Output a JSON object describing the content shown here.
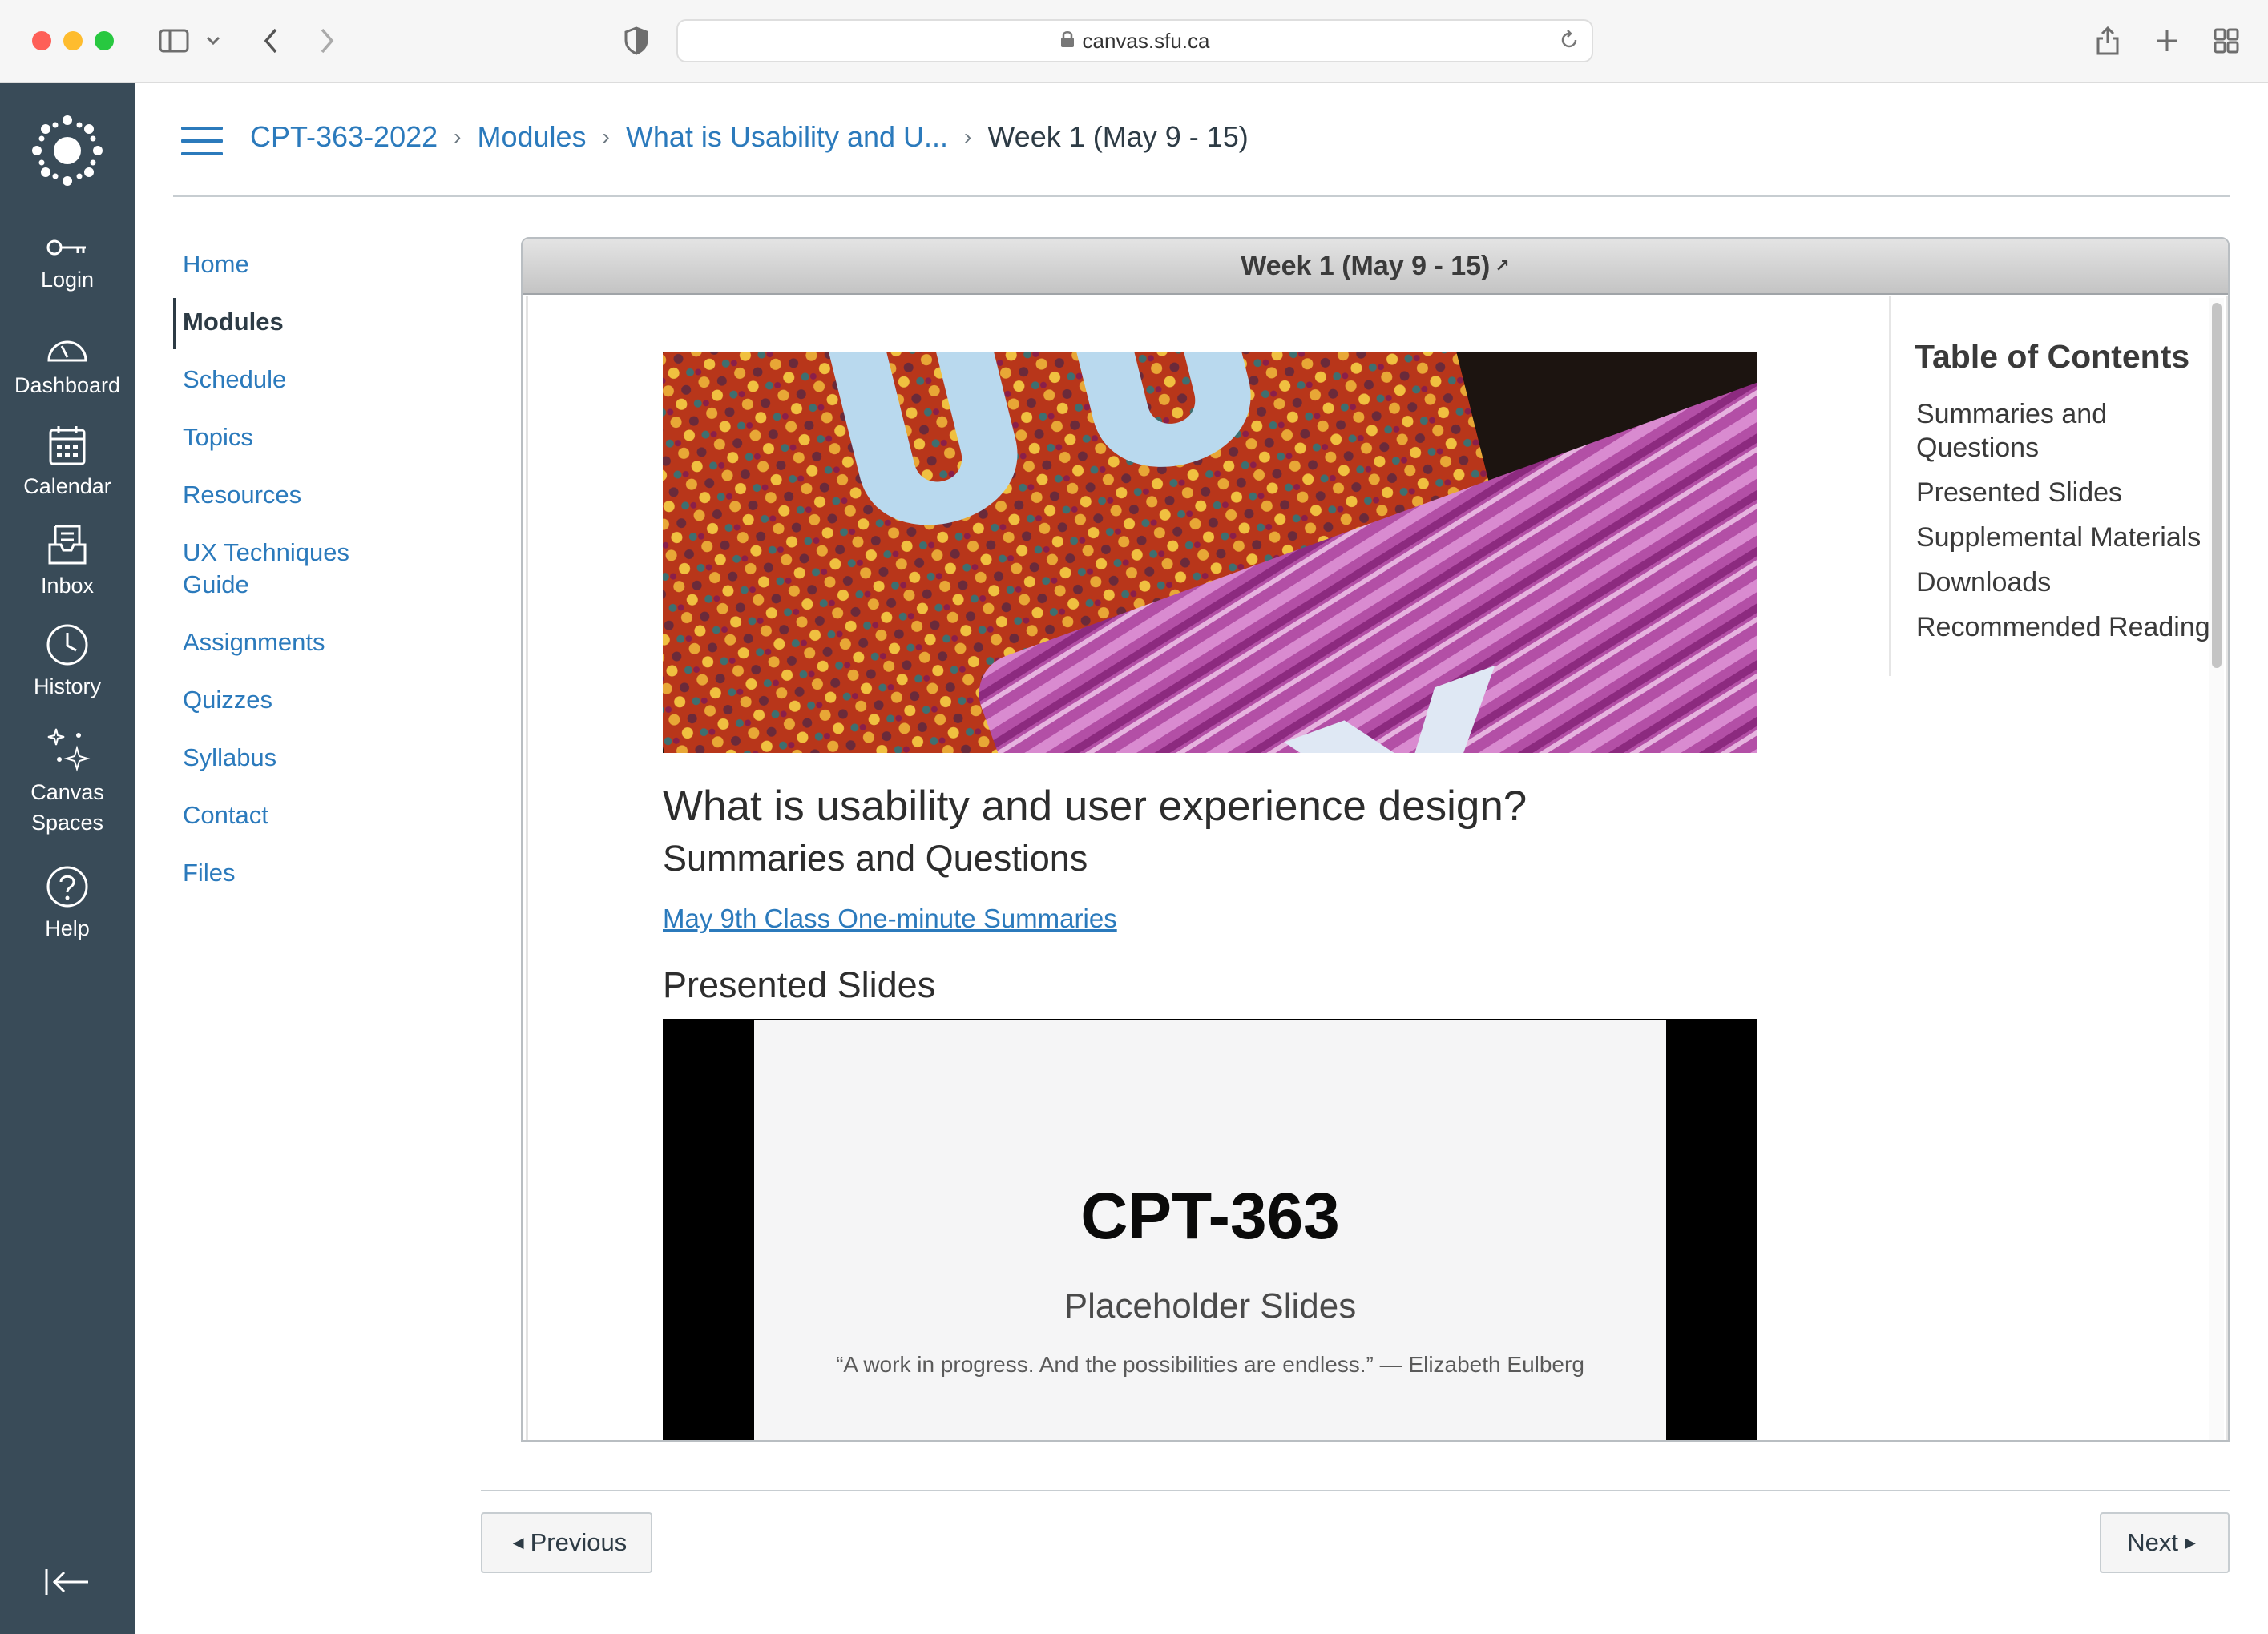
{
  "browser": {
    "url": "canvas.sfu.ca"
  },
  "global_nav": {
    "items": [
      {
        "label": "Login",
        "icon": "key-icon"
      },
      {
        "label": "Dashboard",
        "icon": "dashboard-icon"
      },
      {
        "label": "Calendar",
        "icon": "calendar-icon"
      },
      {
        "label": "Inbox",
        "icon": "inbox-icon"
      },
      {
        "label": "History",
        "icon": "clock-icon"
      },
      {
        "label": "Canvas",
        "label2": "Spaces",
        "icon": "sparkles-icon"
      },
      {
        "label": "Help",
        "icon": "help-icon"
      }
    ]
  },
  "breadcrumb": {
    "items": [
      "CPT-363-2022",
      "Modules",
      "What is Usability and U..."
    ],
    "current": "Week 1 (May 9 - 15)"
  },
  "course_nav": {
    "items": [
      "Home",
      "Modules",
      "Schedule",
      "Topics",
      "Resources",
      "UX Techniques",
      "Guide",
      "Assignments",
      "Quizzes",
      "Syllabus",
      "Contact",
      "Files"
    ],
    "active": "Modules"
  },
  "frame": {
    "title": "Week 1 (May 9 - 15)",
    "external_icon": "↗"
  },
  "document": {
    "hero_letters": [
      "U",
      "X"
    ],
    "title": "What is usability and user experience design?",
    "section1": "Summaries and Questions",
    "link": "May 9th Class One-minute Summaries",
    "section2": "Presented Slides"
  },
  "slide": {
    "title": "CPT-363",
    "subtitle": "Placeholder Slides",
    "quote": "“A work in progress. And the possibilities are endless.” — Elizabeth Eulberg"
  },
  "toc": {
    "title": "Table of Contents",
    "items": [
      "Summaries and Questions",
      "Presented Slides",
      "Supplemental Materials",
      "Downloads",
      "Recommended Reading"
    ]
  },
  "pager": {
    "previous": "Previous",
    "next": "Next"
  }
}
